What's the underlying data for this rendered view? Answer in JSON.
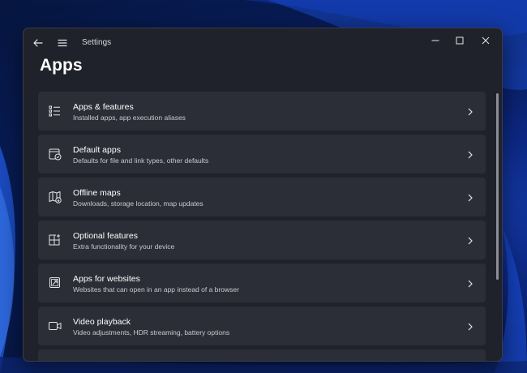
{
  "window": {
    "title": "Settings",
    "controls": {
      "minimize_icon": "minimize-icon",
      "maximize_icon": "maximize-icon",
      "close_icon": "close-icon"
    }
  },
  "nav": {
    "back_icon": "back-arrow-icon",
    "menu_icon": "hamburger-menu-icon"
  },
  "page": {
    "title": "Apps"
  },
  "items": [
    {
      "title": "Apps & features",
      "description": "Installed apps, app execution aliases",
      "icon": "apps-list-icon"
    },
    {
      "title": "Default apps",
      "description": "Defaults for file and link types, other defaults",
      "icon": "default-apps-icon"
    },
    {
      "title": "Offline maps",
      "description": "Downloads, storage location, map updates",
      "icon": "offline-map-icon"
    },
    {
      "title": "Optional features",
      "description": "Extra functionality for your device",
      "icon": "optional-features-icon"
    },
    {
      "title": "Apps for websites",
      "description": "Websites that can open in an app instead of a browser",
      "icon": "apps-for-websites-icon"
    },
    {
      "title": "Video playback",
      "description": "Video adjustments, HDR streaming, battery options",
      "icon": "video-camera-icon"
    }
  ],
  "colors": {
    "window_bg": "#20222b",
    "card_bg": "#2c2e37",
    "text_primary": "#ffffff",
    "text_secondary": "#c8c9cf",
    "wallpaper_blue": "#1f4fd0"
  }
}
